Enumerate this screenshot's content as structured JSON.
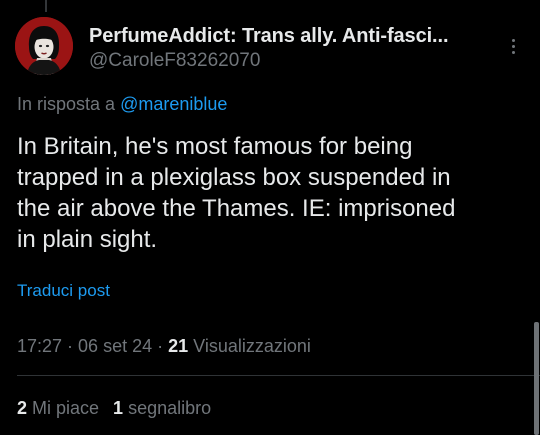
{
  "author": {
    "display_name": "PerfumeAddict: Trans ally. Anti-fasci...",
    "handle": "@CaroleF83262070",
    "avatar_icon": "profile-photo"
  },
  "reply": {
    "prefix": "In risposta a ",
    "mention": "@mareniblue"
  },
  "tweet": {
    "text": "In Britain, he's most famous for being\ntrapped in a plexiglass box suspended in\nthe air above the Thames. IE: imprisoned\nin plain sight.",
    "translate_label": "Traduci post"
  },
  "meta": {
    "time": "17:27",
    "separator": " · ",
    "date": "06 set 24",
    "views_count": "21",
    "views_label": " Visualizzazioni"
  },
  "stats": {
    "likes_count": "2",
    "likes_label": " Mi piace",
    "bookmarks_count": "1",
    "bookmarks_label": " segnalibro"
  },
  "colors": {
    "background": "#000000",
    "text": "#e7e9ea",
    "secondary": "#71767b",
    "accent": "#1d9bf0"
  }
}
